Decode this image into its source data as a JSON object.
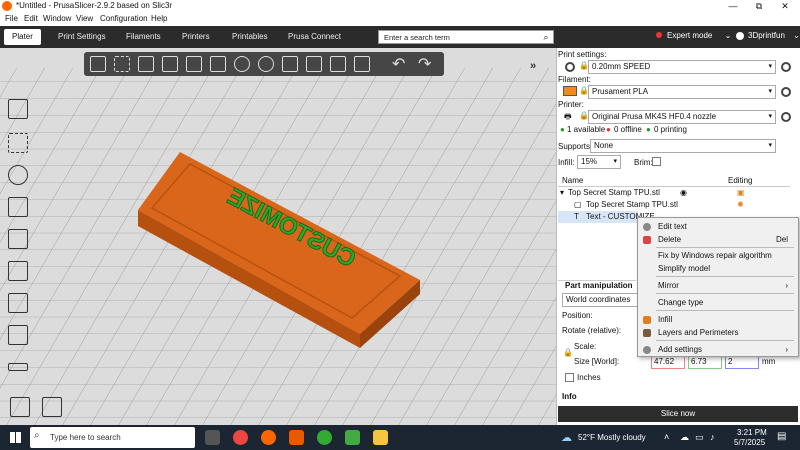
{
  "window": {
    "title": "*Untitled - PrusaSlicer-2.9.2 based on Slic3r",
    "minimize": "—",
    "maximize": "⧉",
    "close": "✕"
  },
  "menu": [
    "File",
    "Edit",
    "Window",
    "View",
    "Configuration",
    "Help"
  ],
  "tabs": [
    "Plater",
    "Print Settings",
    "Filaments",
    "Printers",
    "Printables",
    "Prusa Connect"
  ],
  "search": {
    "placeholder": "Enter a search term"
  },
  "mode": {
    "label": "Expert mode",
    "arrow": "⌄"
  },
  "account": {
    "label": "3Dprintfun",
    "arrow": "⌄"
  },
  "toolbar": {
    "undo": "↶",
    "redo": "↷"
  },
  "viewport": {
    "collapse": "»",
    "model_text": "CUSTOMIZE"
  },
  "sidebar": {
    "print_settings": {
      "label": "Print settings:",
      "value": "0.20mm SPEED"
    },
    "filament": {
      "label": "Filament:",
      "value": "Prusament PLA",
      "color": "#f08a1c"
    },
    "printer": {
      "label": "Printer:",
      "value": "Original Prusa MK4S HF0.4 nozzle"
    },
    "status": {
      "available": "1 available",
      "offline": "0 offline",
      "printing": "0 printing"
    },
    "supports": {
      "label": "Supports:",
      "value": "None"
    },
    "infill": {
      "label": "Infill:",
      "value": "15%"
    },
    "brim": {
      "label": "Brim:"
    },
    "object_list": {
      "col_name": "Name",
      "col_editing": "Editing",
      "rows": [
        "Top Secret Stamp TPU.stl",
        "Top Secret Stamp TPU.stl",
        "Text - CUSTOMIZE"
      ]
    },
    "part_manipulation": {
      "title": "Part manipulation",
      "coords": "World coordinates",
      "position": "Position:",
      "rotate": "Rotate (relative):",
      "scale": "Scale:",
      "size": "Size [World]:",
      "size_x": "47.62",
      "size_y": "6.73",
      "size_z": "2",
      "unit": "mm",
      "inches": "Inches"
    },
    "info": "Info",
    "slice": "Slice now"
  },
  "context_menu": {
    "items": [
      {
        "label": "Edit text",
        "key": "",
        "icon": "#888"
      },
      {
        "label": "Delete",
        "key": "Del",
        "icon": "#d44"
      },
      {
        "label": "Fix by Windows repair algorithm",
        "key": "",
        "icon": ""
      },
      {
        "label": "Simplify model",
        "key": "",
        "icon": ""
      },
      {
        "label": "Mirror",
        "key": "›",
        "icon": ""
      },
      {
        "label": "Change type",
        "key": "",
        "icon": ""
      },
      {
        "label": "Infill",
        "key": "",
        "icon": "#e0801a"
      },
      {
        "label": "Layers and Perimeters",
        "key": "",
        "icon": "#7a5a3a"
      },
      {
        "label": "Add settings",
        "key": "›",
        "icon": "#888"
      }
    ]
  },
  "taskbar": {
    "search_placeholder": "Type here to search",
    "weather": "52°F  Mostly cloudy",
    "time": "3:21 PM",
    "date": "5/7/2025"
  }
}
